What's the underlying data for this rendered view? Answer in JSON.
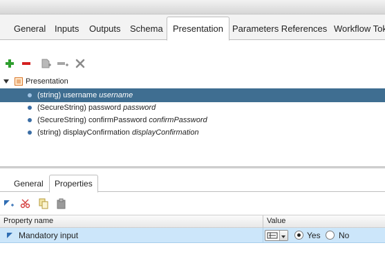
{
  "tabs": [
    {
      "label": "General"
    },
    {
      "label": "Inputs"
    },
    {
      "label": "Outputs"
    },
    {
      "label": "Schema"
    },
    {
      "label": "Presentation"
    },
    {
      "label": "Parameters References"
    },
    {
      "label": "Workflow Tok"
    }
  ],
  "active_tab": "Presentation",
  "tree": {
    "root_label": "Presentation",
    "items": [
      {
        "type": "(string)",
        "name": "username",
        "alias": "username",
        "selected": true
      },
      {
        "type": "(SecureString)",
        "name": "password",
        "alias": "password",
        "selected": false
      },
      {
        "type": "(SecureString)",
        "name": "confirmPassword",
        "alias": "confirmPassword",
        "selected": false
      },
      {
        "type": "(string)",
        "name": "displayConfirmation",
        "alias": "displayConfirmation",
        "selected": false
      }
    ]
  },
  "bottom_tabs": [
    {
      "label": "General"
    },
    {
      "label": "Properties"
    }
  ],
  "active_bottom_tab": "Properties",
  "properties_table": {
    "headers": {
      "name": "Property name",
      "value": "Value"
    },
    "rows": [
      {
        "name": "Mandatory input",
        "yes_label": "Yes",
        "no_label": "No",
        "selected": "Yes"
      }
    ]
  },
  "colors": {
    "selection": "#3f6e91",
    "row_highlight": "#cce6fa",
    "add_green": "#2e9e2e",
    "remove_red": "#d42020"
  }
}
